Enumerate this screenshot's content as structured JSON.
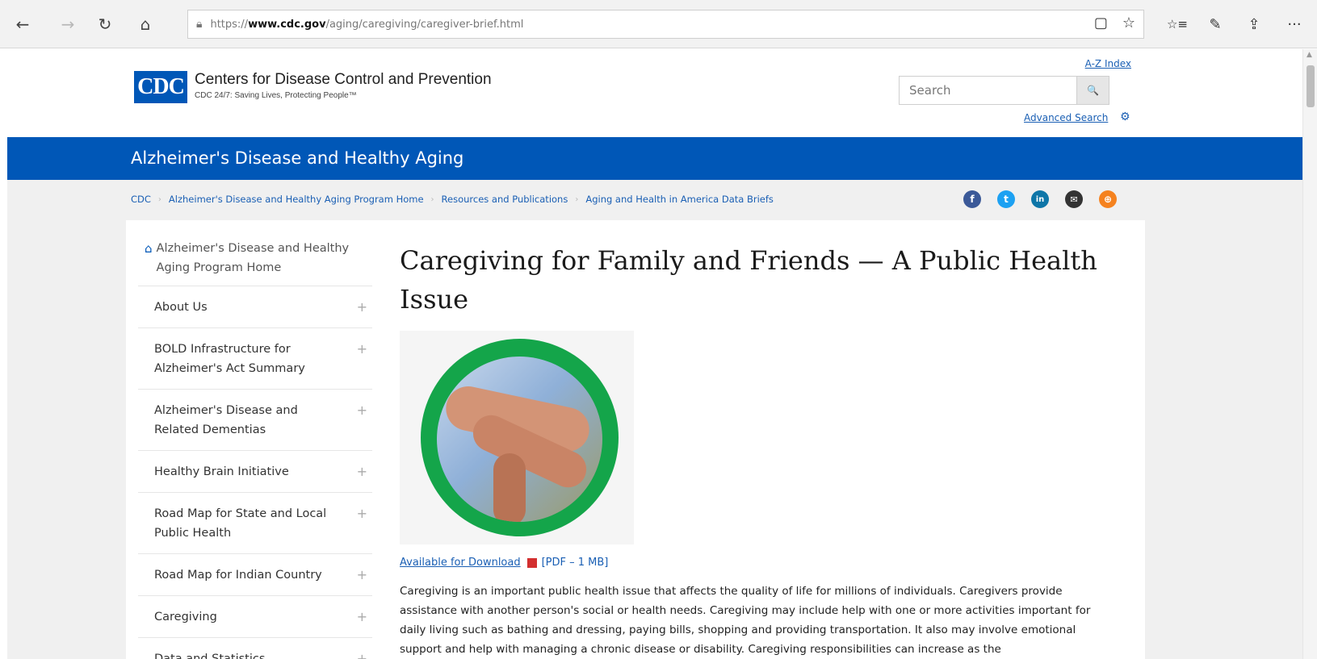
{
  "browser": {
    "back_icon": "←",
    "forward_icon": "→",
    "refresh_icon": "↻",
    "home_icon": "⌂",
    "url_scheme": "https://",
    "url_host": "www.cdc.gov",
    "url_path": "/aging/caregiving/caregiver-brief.html",
    "reading_view_icon": "▢",
    "favorite_icon": "☆",
    "favorites_icon": "☆≡",
    "notes_icon": "✎",
    "share_icon": "⇪",
    "more_icon": "···"
  },
  "header": {
    "logo_text": "CDC",
    "org_name": "Centers for Disease Control and Prevention",
    "tagline": "CDC 24/7: Saving Lives, Protecting People™",
    "az_index": "A-Z Index",
    "search_placeholder": "Search",
    "search_icon": "🔍",
    "advanced_search": "Advanced Search",
    "advanced_search_icon": "⚙"
  },
  "section": {
    "title": "Alzheimer's Disease and Healthy Aging"
  },
  "breadcrumb": {
    "items": [
      "CDC",
      "Alzheimer's Disease and Healthy Aging Program Home",
      "Resources and Publications",
      "Aging and Health in America Data Briefs"
    ],
    "separator": "›"
  },
  "social": {
    "facebook": "f",
    "twitter": "t",
    "linkedin": "in",
    "email": "✉",
    "syndicate": "⊕",
    "colors": {
      "facebook": "#3b5998",
      "twitter": "#1da1f2",
      "linkedin": "#0e76a8",
      "email": "#333333",
      "syndicate": "#f5821f"
    }
  },
  "sidebar": {
    "home_label": "Alzheimer's Disease and Healthy Aging Program Home",
    "items": [
      {
        "label": "About Us",
        "expander": "+"
      },
      {
        "label": "BOLD Infrastructure for Alzheimer's Act Summary",
        "expander": "+"
      },
      {
        "label": "Alzheimer's Disease and Related Dementias",
        "expander": "+"
      },
      {
        "label": "Healthy Brain Initiative",
        "expander": "+"
      },
      {
        "label": "Road Map for State and Local Public Health",
        "expander": "+"
      },
      {
        "label": "Road Map for Indian Country",
        "expander": "+"
      },
      {
        "label": "Caregiving",
        "expander": "+"
      },
      {
        "label": "Data and Statistics",
        "expander": "+"
      }
    ]
  },
  "main": {
    "title": "Caregiving for Family and Friends — A Public Health Issue",
    "download_link": "Available for Download",
    "download_meta": "[PDF – 1 MB]",
    "body": "Caregiving is an important public health issue that affects the quality of life for millions of individuals. Caregivers provide assistance with another person's social or health needs.  Caregiving may include help with one or more activities important for daily living such as bathing and dressing, paying bills, shopping and providing transportation. It also may involve emotional support and help with managing a chronic disease or disability. Caregiving responsibilities can increase as the"
  },
  "colors": {
    "brand_blue": "#0057b7",
    "link_blue": "#1a5fb4",
    "hero_green": "#14a54a"
  }
}
